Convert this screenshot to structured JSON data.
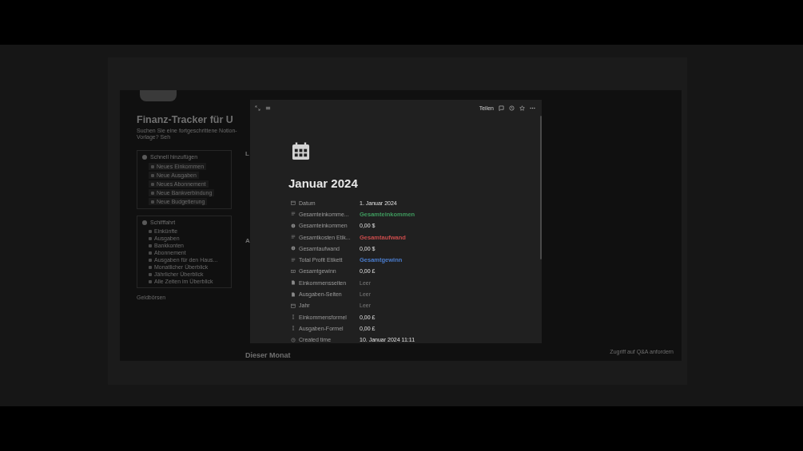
{
  "page": {
    "title": "Finanz-Tracker für U",
    "subtitle": "Suchen Sie eine fortgeschrittene Notion-Vorlage? Seh",
    "quick_add": {
      "title": "Schnell hinzufügen",
      "items": [
        "Neues Einkommen",
        "Neue Ausgaben",
        "Neues Abonnement",
        "Neue Bankverbindung",
        "Neue Budgetierung"
      ]
    },
    "navigation": {
      "title": "Schifffahrt",
      "items": [
        "Einkünfte",
        "Ausgaben",
        "Bankkonten",
        "Abonnement",
        "Ausgaben für den Haus...",
        "Monatlicher Überblick",
        "Jährlicher Überblick",
        "Alle Zeiten im Überblick"
      ]
    },
    "section_after": "Geldbörsen",
    "right_headings": [
      "L",
      "A"
    ],
    "month_heading": "Dieser Monat",
    "access_request": "Zugriff auf Q&A anfordern"
  },
  "modal": {
    "share": "Teilen",
    "title": "Januar 2024",
    "properties": [
      {
        "label": "Datum",
        "value": "1. Januar 2024",
        "kind": "plain"
      },
      {
        "label": "Gesamteinkomme...",
        "value": "Gesamteinkommen",
        "kind": "colored",
        "color": "#3f9a5e"
      },
      {
        "label": "Gesamteinkommen",
        "value": "0,00 $",
        "kind": "plain"
      },
      {
        "label": "Gesamtkosten Etik...",
        "value": "Gesamtaufwand",
        "kind": "colored",
        "color": "#c84b4b"
      },
      {
        "label": "Gesamtaufwand",
        "value": "0,00 $",
        "kind": "plain"
      },
      {
        "label": "Total Profit Etikett",
        "value": "Gesamtgewinn",
        "kind": "colored",
        "color": "#4a7ccc"
      },
      {
        "label": "Gesamtgewinn",
        "value": "0,00 £",
        "kind": "plain"
      },
      {
        "label": "Einkommensseiten",
        "value": "Leer",
        "kind": "empty"
      },
      {
        "label": "Ausgaben-Seiten",
        "value": "Leer",
        "kind": "empty"
      },
      {
        "label": "Jahr",
        "value": "Leer",
        "kind": "empty"
      },
      {
        "label": "Einkommensformel",
        "value": "0,00 £",
        "kind": "plain"
      },
      {
        "label": "Ausgaben-Formel",
        "value": "0,00 £",
        "kind": "plain"
      },
      {
        "label": "Created time",
        "value": "10. Januar 2024 11:11",
        "kind": "plain"
      }
    ]
  }
}
